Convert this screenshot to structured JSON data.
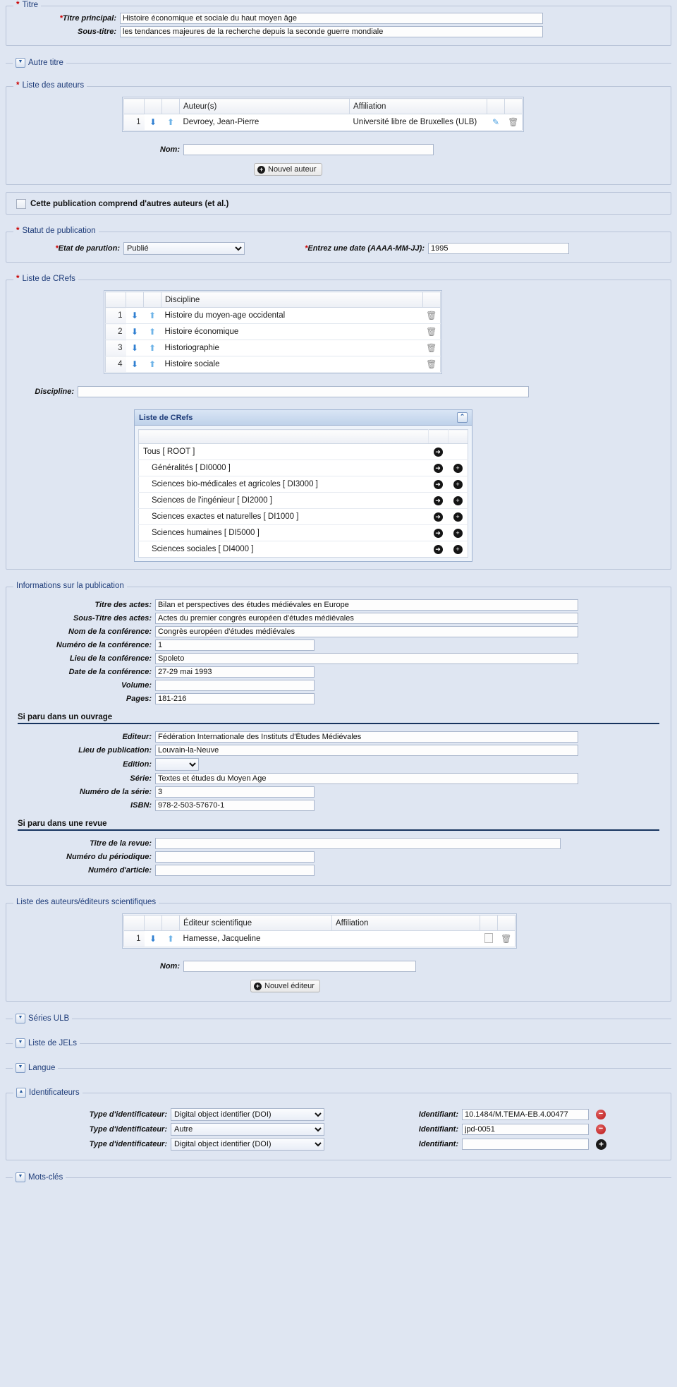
{
  "sections": {
    "titre": {
      "legend": "Titre",
      "required": true,
      "fields": [
        {
          "label": "*Titre principal:",
          "value": "Histoire économique et sociale du haut moyen âge"
        },
        {
          "label": "Sous-titre:",
          "value": "les tendances majeures de la recherche depuis la seconde guerre mondiale"
        }
      ]
    },
    "autre_titre": {
      "legend": "Autre titre",
      "collapsed": true
    },
    "auteurs": {
      "legend": "Liste des auteurs",
      "required": true,
      "columns": [
        "Auteur(s)",
        "Affiliation"
      ],
      "rows": [
        {
          "index": "1",
          "auteur": "Devroey, Jean-Pierre",
          "affiliation": "Université libre de Bruxelles (ULB)"
        }
      ],
      "nom_label": "Nom:",
      "nom_value": "",
      "add_button": "Nouvel auteur",
      "etal_label": "Cette publication comprend d'autres auteurs (et al.)"
    },
    "statut": {
      "legend": "Statut de publication",
      "required": true,
      "etat_label": "*Etat de parution:",
      "etat_value": "Publié",
      "date_label": "*Entrez une date (AAAA-MM-JJ):",
      "date_value": "1995"
    },
    "crefs": {
      "legend": "Liste de CRefs",
      "required": true,
      "column": "Discipline",
      "rows": [
        {
          "index": "1",
          "discipline": "Histoire du moyen-age occidental"
        },
        {
          "index": "2",
          "discipline": "Histoire économique"
        },
        {
          "index": "3",
          "discipline": "Historiographie"
        },
        {
          "index": "4",
          "discipline": "Histoire sociale"
        }
      ],
      "discipline_label": "Discipline:",
      "discipline_value": "",
      "panel_title": "Liste de CRefs",
      "tree": [
        {
          "label": "Tous [ ROOT ]",
          "level": 0,
          "has_add": false
        },
        {
          "label": "Généralités [ DI0000 ]",
          "level": 1,
          "has_add": true
        },
        {
          "label": "Sciences bio-médicales et agricoles [ DI3000 ]",
          "level": 1,
          "has_add": true
        },
        {
          "label": "Sciences de l'ingénieur [ DI2000 ]",
          "level": 1,
          "has_add": true
        },
        {
          "label": "Sciences exactes et naturelles [ DI1000 ]",
          "level": 1,
          "has_add": true
        },
        {
          "label": "Sciences humaines [ DI5000 ]",
          "level": 1,
          "has_add": true
        },
        {
          "label": "Sciences sociales [ DI4000 ]",
          "level": 1,
          "has_add": true
        }
      ]
    },
    "infos_publication": {
      "legend": "Informations sur la publication",
      "fields": [
        {
          "label": "Titre des actes:",
          "value": "Bilan et perspectives des études médiévales en Europe",
          "size": "full"
        },
        {
          "label": "Sous-Titre des actes:",
          "value": "Actes du premier congrès européen d'études médiévales",
          "size": "full"
        },
        {
          "label": "Nom de la conférence:",
          "value": "Congrès européen d'études médiévales",
          "size": "full"
        },
        {
          "label": "Numéro de la conférence:",
          "value": "1",
          "size": "small"
        },
        {
          "label": "Lieu de la conférence:",
          "value": "Spoleto",
          "size": "full"
        },
        {
          "label": "Date de la conférence:",
          "value": "27-29 mai 1993",
          "size": "small"
        },
        {
          "label": "Volume:",
          "value": "",
          "size": "small"
        },
        {
          "label": "Pages:",
          "value": "181-216",
          "size": "small"
        }
      ],
      "ouvrage_heading": "Si paru dans un ouvrage",
      "ouvrage_fields": [
        {
          "label": "Editeur:",
          "value": "Fédération Internationale des Instituts d'Études Médiévales",
          "size": "full",
          "type": "text"
        },
        {
          "label": "Lieu de publication:",
          "value": "Louvain-la-Neuve",
          "size": "full",
          "type": "text"
        },
        {
          "label": "Edition:",
          "value": "",
          "size": "sel",
          "type": "select"
        },
        {
          "label": "Série:",
          "value": "Textes et études du Moyen Age",
          "size": "full",
          "type": "text"
        },
        {
          "label": "Numéro de la série:",
          "value": "3",
          "size": "small",
          "type": "text"
        },
        {
          "label": "ISBN:",
          "value": "978-2-503-57670-1",
          "size": "small",
          "type": "text"
        }
      ],
      "revue_heading": "Si paru dans une revue",
      "revue_fields": [
        {
          "label": "Titre de la revue:",
          "value": "",
          "size": "rev"
        },
        {
          "label": "Numéro du périodique:",
          "value": "",
          "size": "small"
        },
        {
          "label": "Numéro d'article:",
          "value": "",
          "size": "small"
        }
      ]
    },
    "editeurs": {
      "legend": "Liste des auteurs/éditeurs scientifiques",
      "columns": [
        "Éditeur scientifique",
        "Affiliation"
      ],
      "rows": [
        {
          "index": "1",
          "editeur": "Hamesse, Jacqueline",
          "affiliation": ""
        }
      ],
      "nom_label": "Nom:",
      "nom_value": "",
      "add_button": "Nouvel éditeur"
    },
    "collapsed": [
      {
        "legend": "Séries ULB"
      },
      {
        "legend": "Liste de JELs"
      },
      {
        "legend": "Langue"
      }
    ],
    "identificateurs": {
      "legend": "Identificateurs",
      "expanded": true,
      "type_label": "Type d'identificateur:",
      "ident_label": "Identifiant:",
      "rows": [
        {
          "type": "Digital object identifier (DOI)",
          "value": "10.1484/M.TEMA-EB.4.00477",
          "action": "minus"
        },
        {
          "type": "Autre",
          "value": "jpd-0051",
          "action": "minus"
        },
        {
          "type": "Digital object identifier (DOI)",
          "value": "",
          "action": "plus"
        }
      ]
    },
    "motscles": {
      "legend": "Mots-clés",
      "collapsed": true
    }
  },
  "icons": {
    "arrow_down": "⬇",
    "arrow_up": "⬆",
    "pencil": "✎",
    "trash": "🗑",
    "plus": "+",
    "minus": "−",
    "go": "➜",
    "chevron_down": "▼",
    "chevron_up": "▲",
    "collapse_up": "⌃",
    "select_caret": "⌄"
  },
  "colors": {
    "page_bg": "#dfe6f2",
    "legend": "#1f3d7a",
    "required": "#cc0000",
    "arrow_down": "#2f7fd1",
    "arrow_up": "#6fb4e8",
    "rule": "#16335e",
    "minus": "#bb1b1b"
  }
}
